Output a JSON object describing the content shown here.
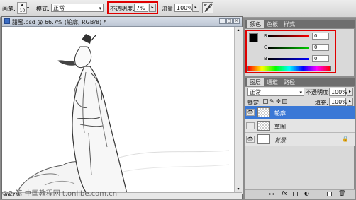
{
  "options_bar": {
    "brush_label": "画笔:",
    "brush_size": "10",
    "mode_label": "模式:",
    "mode_value": "正常",
    "opacity_label": "不透明度:",
    "opacity_value": "7%",
    "flow_label": "流量:",
    "flow_value": "100%"
  },
  "document": {
    "title": "甜蜜.psd @ 66.7% (轮廓, RGB/8) *",
    "zoom": "66.7%"
  },
  "color_panel": {
    "tabs": [
      "颜色",
      "色板",
      "样式"
    ],
    "channels": [
      {
        "label": "R",
        "value": "0",
        "color": "#d01010"
      },
      {
        "label": "G",
        "value": "0",
        "color": "#10a010"
      },
      {
        "label": "B",
        "value": "0",
        "color": "#1030d0"
      }
    ]
  },
  "layers_panel": {
    "tabs": [
      "图层",
      "通道",
      "路径"
    ],
    "blend_mode": "正常",
    "opacity_label": "不透明度:",
    "opacity_value": "100%",
    "lock_label": "锁定:",
    "fill_label": "填充:",
    "fill_value": "100%",
    "layers": [
      {
        "name": "轮廓",
        "selected": true,
        "visible": true
      },
      {
        "name": "草图",
        "selected": false,
        "visible": false
      },
      {
        "name": "背景",
        "selected": false,
        "visible": true
      }
    ]
  },
  "watermark": "©2 第 中国教程网 t.onlibe.com.cn",
  "colors": {
    "highlight": "#e00000",
    "selection": "#3a78d6"
  }
}
